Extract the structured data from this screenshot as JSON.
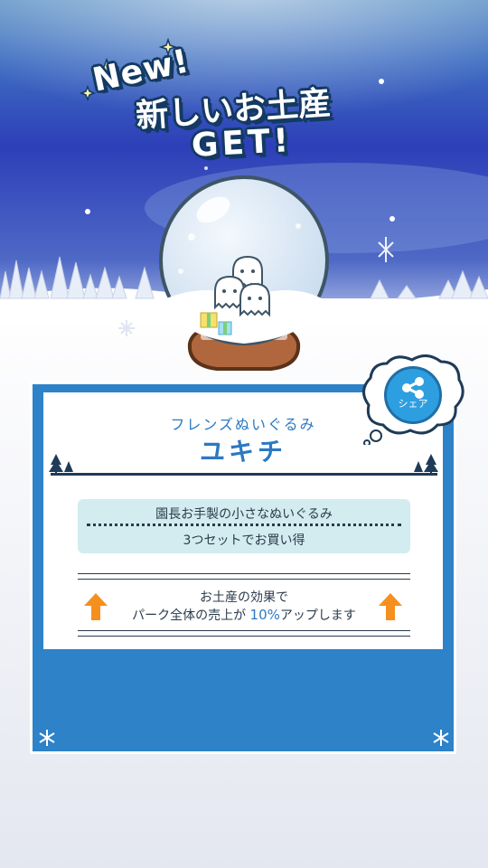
{
  "title": {
    "new_label": "New!",
    "main_label": "新しいお土産",
    "get_label": "GET!"
  },
  "item": {
    "category": "フレンズぬいぐるみ",
    "name": "ユキチ",
    "description_line1": "園長お手製の小さなぬいぐるみ",
    "description_line2": "3つセットでお買い得",
    "effect_line1": "お土産の効果で",
    "effect_line2_prefix": "パーク全体の売上が ",
    "effect_percent": "10%",
    "effect_line2_suffix": "アップします"
  },
  "share": {
    "label": "シェア"
  },
  "colors": {
    "accent_blue": "#2b79c2",
    "card_blue": "#2d82c8",
    "arrow_orange": "#f5901e",
    "desc_box": "#d3ecef"
  },
  "icons": [
    "sparkle-icon",
    "share-icon",
    "up-arrow-icon",
    "snowflake-icon",
    "pine-tree-icon",
    "snow-globe-icon"
  ]
}
